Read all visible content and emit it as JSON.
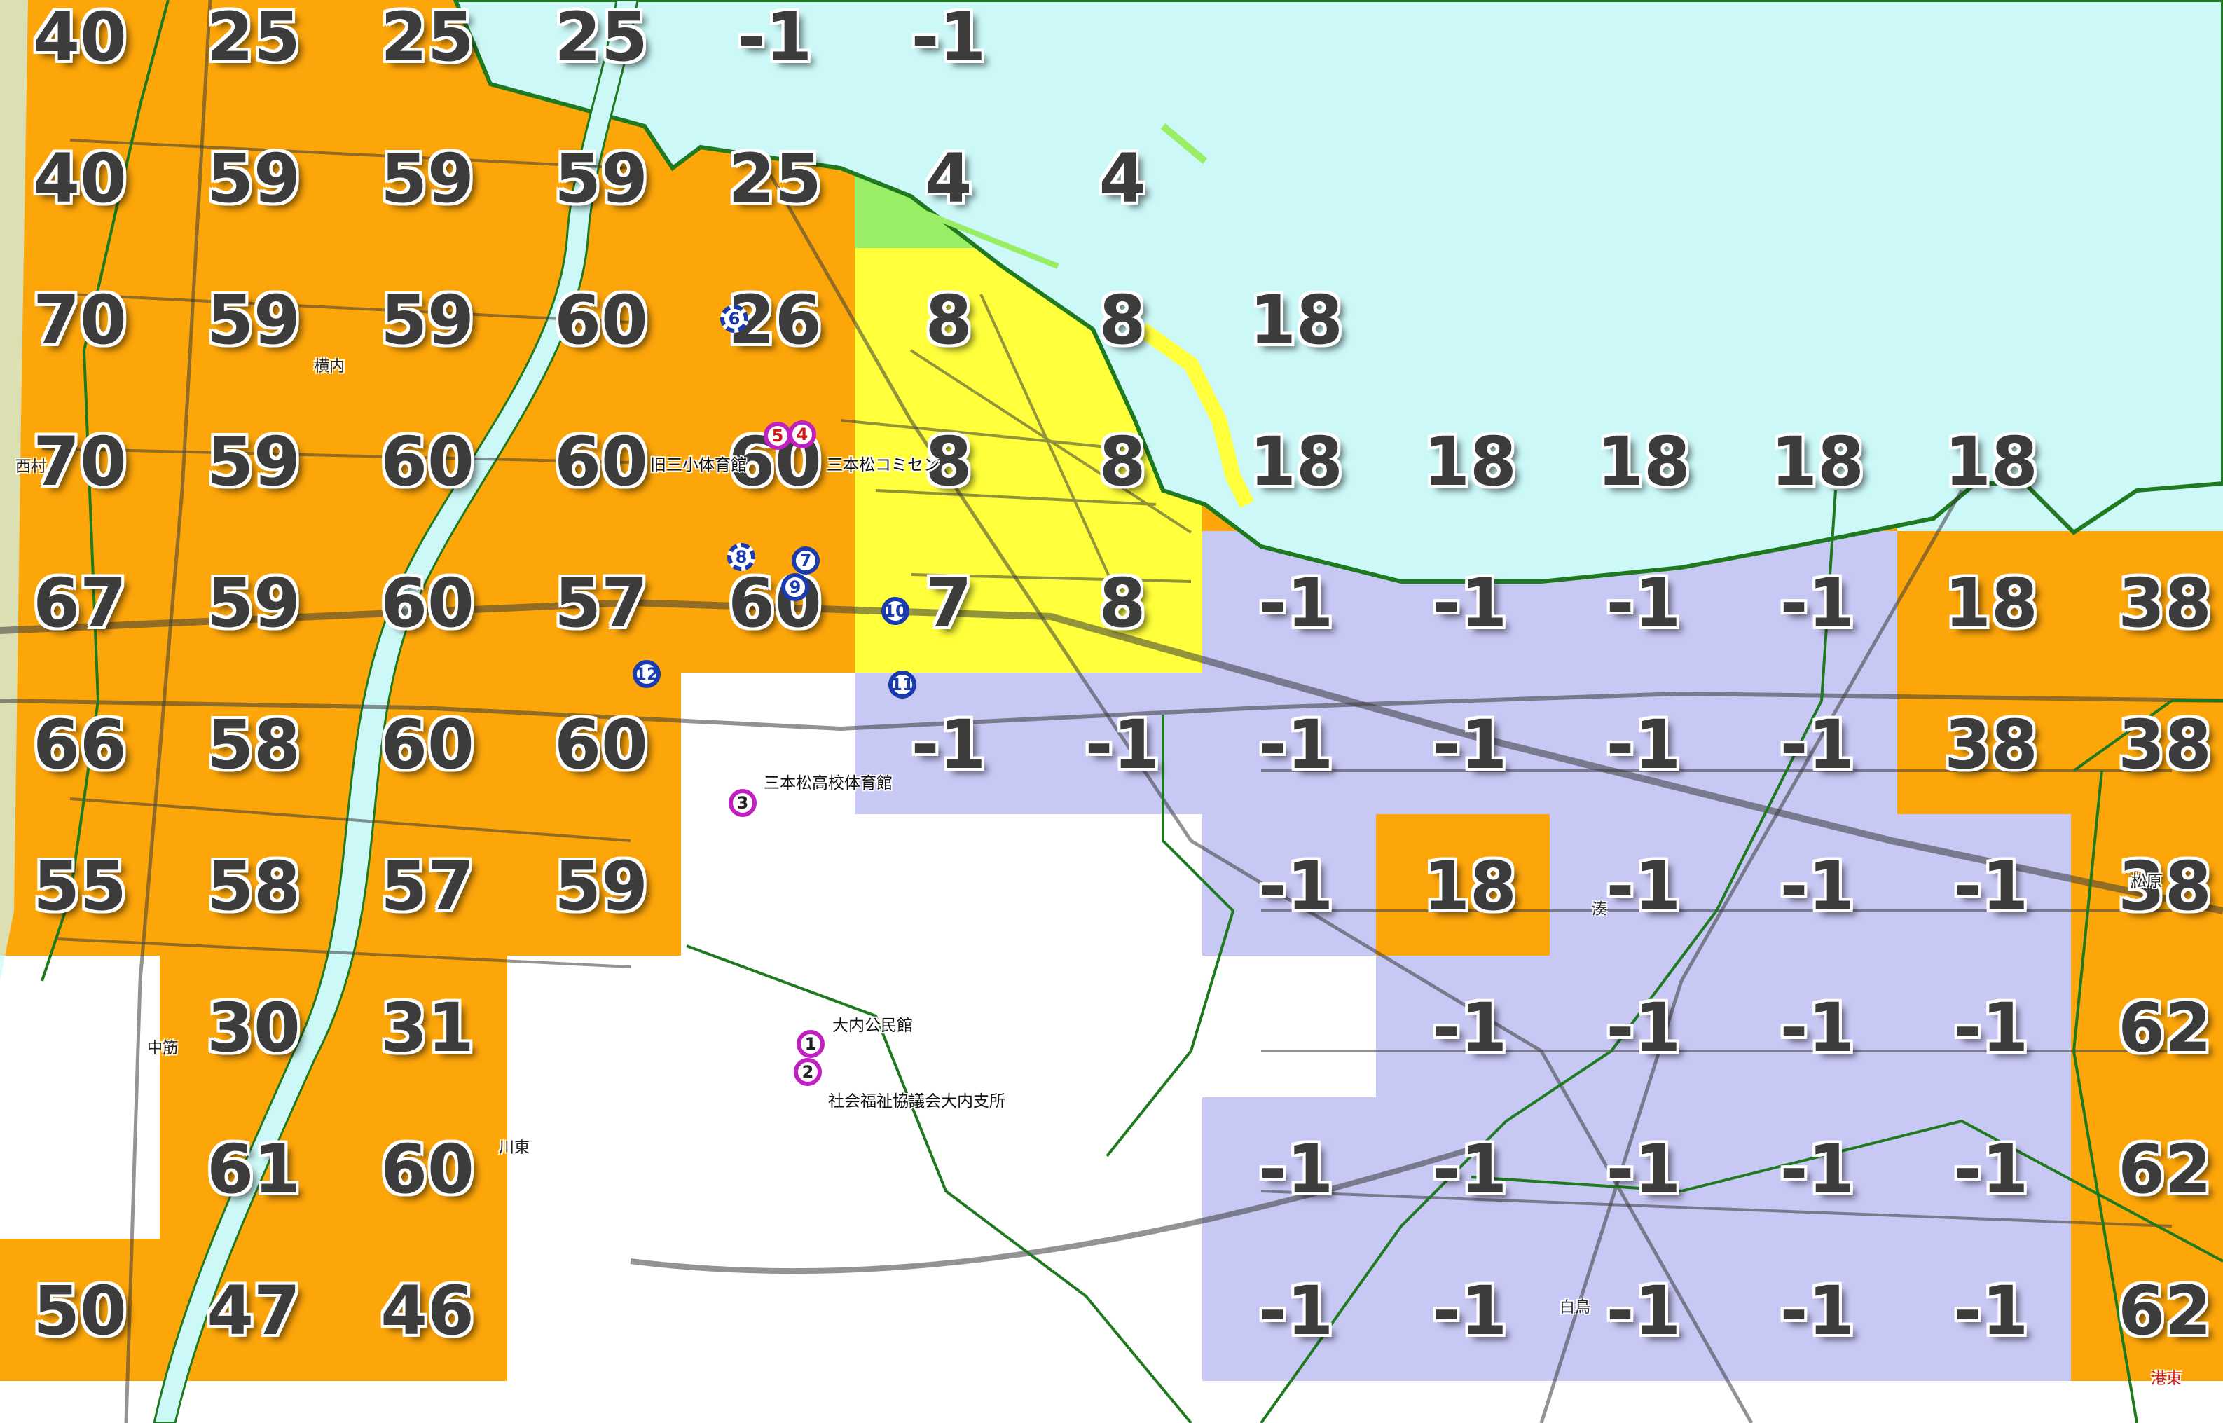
{
  "legend": {
    "colors": {
      "sea": "#ccf8f8",
      "orange": "#fda60a",
      "yellow": "#ffff3b",
      "lavender": "#c8c8f5",
      "green": "#99ee66",
      "white": "#ffffff",
      "boundary": "#1f7a1f",
      "road": "#3a3a3a"
    }
  },
  "grid": {
    "columns": 13,
    "rows": 10,
    "rows_data": [
      [
        {
          "v": "40",
          "c": "orange"
        },
        {
          "v": "25",
          "c": "orange"
        },
        {
          "v": "25",
          "c": "orange"
        },
        {
          "v": "25",
          "c": "orange"
        },
        {
          "v": "-1",
          "c": "lavender"
        },
        {
          "v": "-1",
          "c": "lavender"
        },
        {
          "v": "",
          "c": "sea"
        },
        {
          "v": "",
          "c": "sea"
        },
        {
          "v": "",
          "c": "sea"
        },
        {
          "v": "",
          "c": "sea"
        },
        {
          "v": "",
          "c": "sea"
        },
        {
          "v": "",
          "c": "sea"
        },
        {
          "v": "",
          "c": "sea"
        }
      ],
      [
        {
          "v": "40",
          "c": "orange"
        },
        {
          "v": "59",
          "c": "orange"
        },
        {
          "v": "59",
          "c": "orange"
        },
        {
          "v": "59",
          "c": "orange"
        },
        {
          "v": "25",
          "c": "orange"
        },
        {
          "v": "4",
          "c": "green"
        },
        {
          "v": "4",
          "c": "sea"
        },
        {
          "v": "",
          "c": "sea"
        },
        {
          "v": "",
          "c": "sea"
        },
        {
          "v": "",
          "c": "sea"
        },
        {
          "v": "",
          "c": "sea"
        },
        {
          "v": "",
          "c": "sea"
        },
        {
          "v": "",
          "c": "sea"
        }
      ],
      [
        {
          "v": "70",
          "c": "orange"
        },
        {
          "v": "59",
          "c": "orange"
        },
        {
          "v": "59",
          "c": "orange"
        },
        {
          "v": "60",
          "c": "orange"
        },
        {
          "v": "26",
          "c": "orange"
        },
        {
          "v": "8",
          "c": "yellow"
        },
        {
          "v": "8",
          "c": "yellow"
        },
        {
          "v": "18",
          "c": "sea"
        },
        {
          "v": "",
          "c": "sea"
        },
        {
          "v": "",
          "c": "sea"
        },
        {
          "v": "",
          "c": "sea"
        },
        {
          "v": "",
          "c": "sea"
        },
        {
          "v": "",
          "c": "sea"
        }
      ],
      [
        {
          "v": "70",
          "c": "orange"
        },
        {
          "v": "59",
          "c": "orange"
        },
        {
          "v": "60",
          "c": "orange"
        },
        {
          "v": "60",
          "c": "orange"
        },
        {
          "v": "60",
          "c": "orange"
        },
        {
          "v": "8",
          "c": "yellow"
        },
        {
          "v": "8",
          "c": "yellow"
        },
        {
          "v": "18",
          "c": "orange"
        },
        {
          "v": "18",
          "c": "sea"
        },
        {
          "v": "18",
          "c": "sea"
        },
        {
          "v": "18",
          "c": "orange"
        },
        {
          "v": "18",
          "c": "sea"
        },
        {
          "v": "",
          "c": "sea"
        }
      ],
      [
        {
          "v": "67",
          "c": "orange"
        },
        {
          "v": "59",
          "c": "orange"
        },
        {
          "v": "60",
          "c": "orange"
        },
        {
          "v": "57",
          "c": "orange"
        },
        {
          "v": "60",
          "c": "orange"
        },
        {
          "v": "7",
          "c": "yellow"
        },
        {
          "v": "8",
          "c": "yellow"
        },
        {
          "v": "-1",
          "c": "lavender"
        },
        {
          "v": "-1",
          "c": "lavender"
        },
        {
          "v": "-1",
          "c": "lavender"
        },
        {
          "v": "-1",
          "c": "lavender"
        },
        {
          "v": "18",
          "c": "orange"
        },
        {
          "v": "38",
          "c": "orange"
        }
      ],
      [
        {
          "v": "66",
          "c": "orange"
        },
        {
          "v": "58",
          "c": "orange"
        },
        {
          "v": "60",
          "c": "orange"
        },
        {
          "v": "60",
          "c": "orange"
        },
        {
          "v": "",
          "c": "white"
        },
        {
          "v": "-1",
          "c": "lavender"
        },
        {
          "v": "-1",
          "c": "lavender"
        },
        {
          "v": "-1",
          "c": "lavender"
        },
        {
          "v": "-1",
          "c": "lavender"
        },
        {
          "v": "-1",
          "c": "lavender"
        },
        {
          "v": "-1",
          "c": "lavender"
        },
        {
          "v": "38",
          "c": "orange"
        },
        {
          "v": "38",
          "c": "orange"
        }
      ],
      [
        {
          "v": "55",
          "c": "orange"
        },
        {
          "v": "58",
          "c": "orange"
        },
        {
          "v": "57",
          "c": "orange"
        },
        {
          "v": "59",
          "c": "orange"
        },
        {
          "v": "",
          "c": "white"
        },
        {
          "v": "",
          "c": "white"
        },
        {
          "v": "",
          "c": "white"
        },
        {
          "v": "-1",
          "c": "lavender"
        },
        {
          "v": "18",
          "c": "orange"
        },
        {
          "v": "-1",
          "c": "lavender"
        },
        {
          "v": "-1",
          "c": "lavender"
        },
        {
          "v": "-1",
          "c": "lavender"
        },
        {
          "v": "38",
          "c": "orange"
        }
      ],
      [
        {
          "v": "",
          "c": "white"
        },
        {
          "v": "30",
          "c": "orange"
        },
        {
          "v": "31",
          "c": "orange"
        },
        {
          "v": "",
          "c": "white"
        },
        {
          "v": "",
          "c": "white"
        },
        {
          "v": "",
          "c": "white"
        },
        {
          "v": "",
          "c": "white"
        },
        {
          "v": "",
          "c": "white"
        },
        {
          "v": "-1",
          "c": "lavender"
        },
        {
          "v": "-1",
          "c": "lavender"
        },
        {
          "v": "-1",
          "c": "lavender"
        },
        {
          "v": "-1",
          "c": "lavender"
        },
        {
          "v": "62",
          "c": "orange"
        }
      ],
      [
        {
          "v": "",
          "c": "white"
        },
        {
          "v": "61",
          "c": "orange"
        },
        {
          "v": "60",
          "c": "orange"
        },
        {
          "v": "",
          "c": "white"
        },
        {
          "v": "",
          "c": "white"
        },
        {
          "v": "",
          "c": "white"
        },
        {
          "v": "",
          "c": "white"
        },
        {
          "v": "-1",
          "c": "lavender"
        },
        {
          "v": "-1",
          "c": "lavender"
        },
        {
          "v": "-1",
          "c": "lavender"
        },
        {
          "v": "-1",
          "c": "lavender"
        },
        {
          "v": "-1",
          "c": "lavender"
        },
        {
          "v": "62",
          "c": "orange"
        }
      ],
      [
        {
          "v": "50",
          "c": "orange"
        },
        {
          "v": "47",
          "c": "orange"
        },
        {
          "v": "46",
          "c": "orange"
        },
        {
          "v": "",
          "c": "white"
        },
        {
          "v": "",
          "c": "white"
        },
        {
          "v": "",
          "c": "white"
        },
        {
          "v": "",
          "c": "white"
        },
        {
          "v": "-1",
          "c": "lavender"
        },
        {
          "v": "-1",
          "c": "lavender"
        },
        {
          "v": "-1",
          "c": "lavender"
        },
        {
          "v": "-1",
          "c": "lavender"
        },
        {
          "v": "-1",
          "c": "lavender"
        },
        {
          "v": "62",
          "c": "orange"
        }
      ]
    ]
  },
  "place_names": {
    "yokouchi": "横内",
    "nishimura": "西村",
    "nakasuji": "中筋",
    "kawahigashi": "川東",
    "minato": "湊",
    "matsubara": "松原",
    "shiratori": "白鳥",
    "minato_edge": "港東"
  },
  "facilities": {
    "former_gym": "旧三小体育館",
    "community_center": "三本松コミセン",
    "high_school_gym": "三本松高校体育館",
    "ouchi_hall": "大内公民館",
    "welfare_branch": "社会福祉協議会大内支所"
  },
  "markers": [
    {
      "num": "1",
      "kind": "evac"
    },
    {
      "num": "2",
      "kind": "evac"
    },
    {
      "num": "3",
      "kind": "evac"
    },
    {
      "num": "4",
      "kind": "evac-red"
    },
    {
      "num": "5",
      "kind": "evac-red"
    },
    {
      "num": "6",
      "kind": "shelter-dashed"
    },
    {
      "num": "7",
      "kind": "shelter"
    },
    {
      "num": "8",
      "kind": "shelter-dashed"
    },
    {
      "num": "9",
      "kind": "shelter"
    },
    {
      "num": "10",
      "kind": "shelter"
    },
    {
      "num": "11",
      "kind": "shelter"
    },
    {
      "num": "12",
      "kind": "shelter"
    }
  ]
}
